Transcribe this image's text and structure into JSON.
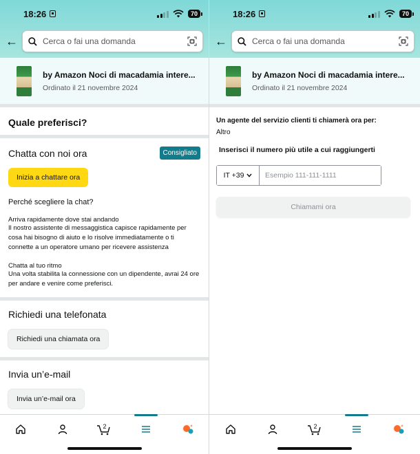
{
  "status": {
    "time": "18:26",
    "battery": "70"
  },
  "search": {
    "placeholder": "Cerca o fai una domanda"
  },
  "order": {
    "title": "by Amazon Noci di macadamia intere...",
    "date": "Ordinato il 21 novembre 2024"
  },
  "left": {
    "question": "Quale preferisci?",
    "chat": {
      "title": "Chatta con noi ora",
      "badge": "Consigliato",
      "button": "Inizia a chattare ora",
      "why": "Perché scegliere la chat?",
      "p1_title": "Arriva rapidamente dove stai andando",
      "p1_text": "Il nostro assistente di messaggistica capisce rapidamente per cosa hai bisogno di aiuto e lo risolve immediatamente o ti connette a un operatore umano per ricevere assistenza",
      "p2_title": "Chatta al tuo ritmo",
      "p2_text": "Una volta stabilita la connessione con un dipendente, avrai 24 ore per andare e venire come preferisci."
    },
    "phone": {
      "title": "Richiedi una telefonata",
      "button": "Richiedi una chiamata ora"
    },
    "email": {
      "title": "Invia un’e-mail",
      "button": "Invia un’e-mail ora"
    }
  },
  "right": {
    "heading": "Un agente del servizio clienti ti chiamerà ora per:",
    "reason": "Altro",
    "label": "Inserisci il numero più utile a cui raggiungerti",
    "country_code": "IT +39",
    "phone_placeholder": "Esempio 111-111-1111",
    "call_button": "Chiamami ora"
  },
  "nav": {
    "cart_count": "2"
  },
  "colors": {
    "accent": "#127b8c",
    "primary_button": "#ffd814",
    "header_gradient": "#7fd8d8"
  }
}
